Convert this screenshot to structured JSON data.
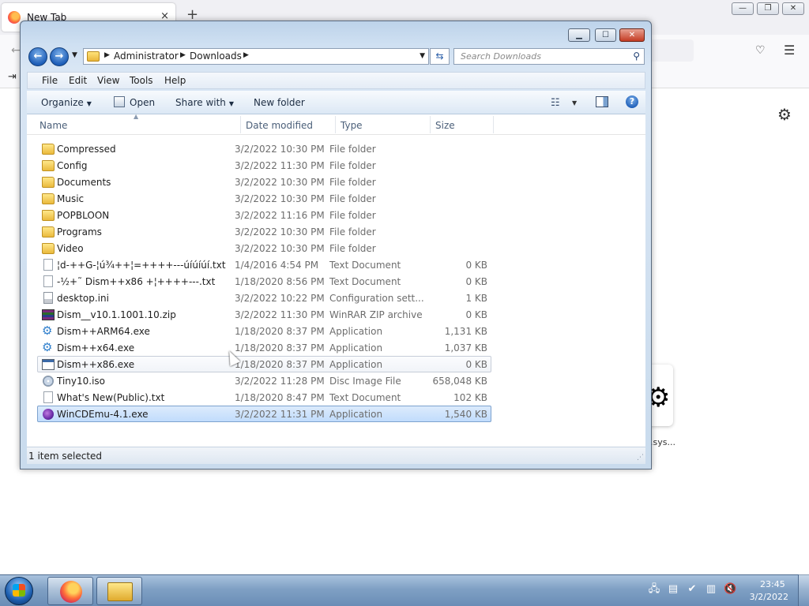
{
  "browser": {
    "tab_title": "New Tab",
    "tab_close": "×",
    "new_tab": "+",
    "tile_label": ".sys..."
  },
  "explorer": {
    "address": {
      "crumbs": [
        "Administrator",
        "Downloads"
      ]
    },
    "search_placeholder": "Search Downloads",
    "menu": [
      "File",
      "Edit",
      "View",
      "Tools",
      "Help"
    ],
    "toolbar": {
      "organize": "Organize",
      "open": "Open",
      "share_with": "Share with",
      "new_folder": "New folder"
    },
    "columns": {
      "name": "Name",
      "date": "Date modified",
      "type": "Type",
      "size": "Size"
    },
    "files": [
      {
        "name": "Compressed",
        "date": "3/2/2022 10:30 PM",
        "type": "File folder",
        "size": "",
        "icon": "folder-icon"
      },
      {
        "name": "Config",
        "date": "3/2/2022 11:30 PM",
        "type": "File folder",
        "size": "",
        "icon": "folder-icon"
      },
      {
        "name": "Documents",
        "date": "3/2/2022 10:30 PM",
        "type": "File folder",
        "size": "",
        "icon": "folder-icon"
      },
      {
        "name": "Music",
        "date": "3/2/2022 10:30 PM",
        "type": "File folder",
        "size": "",
        "icon": "folder-icon"
      },
      {
        "name": "POPBLOON",
        "date": "3/2/2022 11:16 PM",
        "type": "File folder",
        "size": "",
        "icon": "folder-icon"
      },
      {
        "name": "Programs",
        "date": "3/2/2022 10:30 PM",
        "type": "File folder",
        "size": "",
        "icon": "folder-icon"
      },
      {
        "name": "Video",
        "date": "3/2/2022 10:30 PM",
        "type": "File folder",
        "size": "",
        "icon": "folder-icon"
      },
      {
        "name": "¦d-++G-¦ú¾++¦=++++---úíúíúí.txt",
        "date": "1/4/2016 4:54 PM",
        "type": "Text Document",
        "size": "0 KB",
        "icon": "text-file-icon"
      },
      {
        "name": "-½+˜ Dism++x86 +¦++++---.txt",
        "date": "1/18/2020 8:56 PM",
        "type": "Text Document",
        "size": "0 KB",
        "icon": "text-file-icon"
      },
      {
        "name": "desktop.ini",
        "date": "3/2/2022 10:22 PM",
        "type": "Configuration sett...",
        "size": "1 KB",
        "icon": "ini-file-icon"
      },
      {
        "name": "Dism__v10.1.1001.10.zip",
        "date": "3/2/2022 11:30 PM",
        "type": "WinRAR ZIP archive",
        "size": "0 KB",
        "icon": "winrar-archive-icon"
      },
      {
        "name": "Dism++ARM64.exe",
        "date": "1/18/2020 8:37 PM",
        "type": "Application",
        "size": "1,131 KB",
        "icon": "gears-app-icon"
      },
      {
        "name": "Dism++x64.exe",
        "date": "1/18/2020 8:37 PM",
        "type": "Application",
        "size": "1,037 KB",
        "icon": "gears-app-icon"
      },
      {
        "name": "Dism++x86.exe",
        "date": "1/18/2020 8:37 PM",
        "type": "Application",
        "size": "0 KB",
        "icon": "window-app-icon"
      },
      {
        "name": "Tiny10.iso",
        "date": "3/2/2022 11:28 PM",
        "type": "Disc Image File",
        "size": "658,048 KB",
        "icon": "disc-image-icon"
      },
      {
        "name": "What's New(Public).txt",
        "date": "1/18/2020 8:47 PM",
        "type": "Text Document",
        "size": "102 KB",
        "icon": "text-file-icon"
      },
      {
        "name": "WinCDEmu-4.1.exe",
        "date": "3/2/2022 11:31 PM",
        "type": "Application",
        "size": "1,540 KB",
        "icon": "cd-app-icon"
      }
    ],
    "hovered_index": 13,
    "selected_index": 16,
    "status": "1 item selected"
  },
  "taskbar": {
    "time": "23:45",
    "date": "3/2/2022"
  },
  "colors": {
    "selection": "#c1dcfc",
    "selection_border": "#7da2ce",
    "close_button": "#c43b23"
  }
}
